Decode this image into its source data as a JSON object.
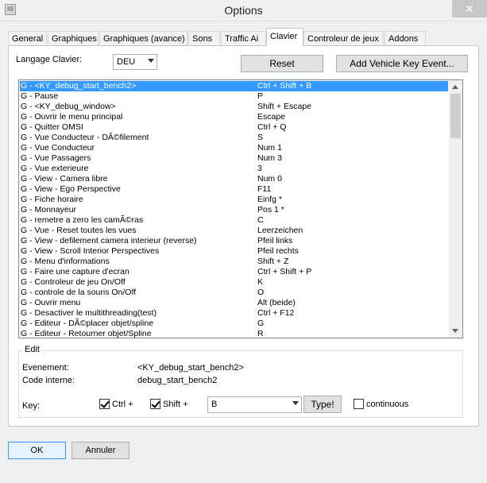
{
  "window": {
    "title": "Options",
    "close_glyph": "✕"
  },
  "tabs": [
    {
      "label": "General",
      "active": false
    },
    {
      "label": "Graphiques",
      "active": false
    },
    {
      "label": "Graphiques (avance)",
      "active": false
    },
    {
      "label": "Sons",
      "active": false
    },
    {
      "label": "Traffic Ai",
      "active": false
    },
    {
      "label": "Clavier",
      "active": true
    },
    {
      "label": "Controleur de jeux",
      "active": false
    },
    {
      "label": "Addons",
      "active": false
    }
  ],
  "keyboard": {
    "language_label": "Langage Clavier:",
    "language_value": "DEU",
    "reset_label": "Reset",
    "add_event_label": "Add Vehicle Key Event..."
  },
  "bindings": [
    {
      "action": "G - <KY_debug_start_bench2>",
      "key": "Ctrl + Shift + B",
      "selected": true
    },
    {
      "action": "G - Pause",
      "key": "P"
    },
    {
      "action": "G - <KY_debug_window>",
      "key": "Shift + Escape"
    },
    {
      "action": "G - Ouvrir le menu principal",
      "key": "Escape"
    },
    {
      "action": "G - Quitter OMSI",
      "key": "Ctrl + Q"
    },
    {
      "action": "G - Vue Conducteur - DÃ©filement",
      "key": "S"
    },
    {
      "action": "G - Vue Conducteur",
      "key": "Num 1"
    },
    {
      "action": "G - Vue Passagers",
      "key": "Num 3"
    },
    {
      "action": "G - Vue exterieure",
      "key": "3"
    },
    {
      "action": "G - View - Camera libre",
      "key": "Num 0"
    },
    {
      "action": "G - View - Ego Perspective",
      "key": "F11"
    },
    {
      "action": "G - Fiche horaire",
      "key": "Einfg *"
    },
    {
      "action": "G - Monnayeur",
      "key": "Pos 1 *"
    },
    {
      "action": "G - remetre a zero les camÃ©ras",
      "key": "C"
    },
    {
      "action": "G - Vue - Reset toutes les vues",
      "key": "Leerzeichen"
    },
    {
      "action": "G - View - defilement camera interieur (reverse)",
      "key": "Pfeil links"
    },
    {
      "action": "G - View - Scroll Interior Perspectives",
      "key": "Pfeil rechts"
    },
    {
      "action": "G - Menu d'informations",
      "key": "Shift + Z"
    },
    {
      "action": "G - Faire une capture d'ecran",
      "key": "Ctrl + Shift + P"
    },
    {
      "action": "G - Controleur de jeu On/Off",
      "key": "K"
    },
    {
      "action": "G - controle de la souris On/Off",
      "key": "O"
    },
    {
      "action": "G - Ouvrir menu",
      "key": "Alt (beide)"
    },
    {
      "action": "G - Desactiver le multithreading(test)",
      "key": "Ctrl + F12"
    },
    {
      "action": "G - Editeur - DÃ©placer objet/spline",
      "key": "G"
    },
    {
      "action": "G - Editeur - Retourner objet/Spline",
      "key": "R"
    }
  ],
  "edit": {
    "legend": "Edit",
    "event_label": "Evenement:",
    "event_value": "<KY_debug_start_bench2>",
    "internal_label": "Code interne:",
    "internal_value": "debug_start_bench2",
    "key_label": "Key:",
    "ctrl_label": "Ctrl +",
    "ctrl_checked": true,
    "shift_label": "Shift +",
    "shift_checked": true,
    "key_value": "B",
    "type_label": "Type!",
    "continuous_label": "continuous",
    "continuous_checked": false
  },
  "footer": {
    "ok_label": "OK",
    "cancel_label": "Annuler"
  },
  "icons": [
    "app-icon",
    "close-icon",
    "chevron-down-icon",
    "scroll-up-icon",
    "scroll-down-icon",
    "checkmark-icon"
  ],
  "colors": {
    "selection": "#3399ff",
    "primary_border": "#3399ff"
  }
}
